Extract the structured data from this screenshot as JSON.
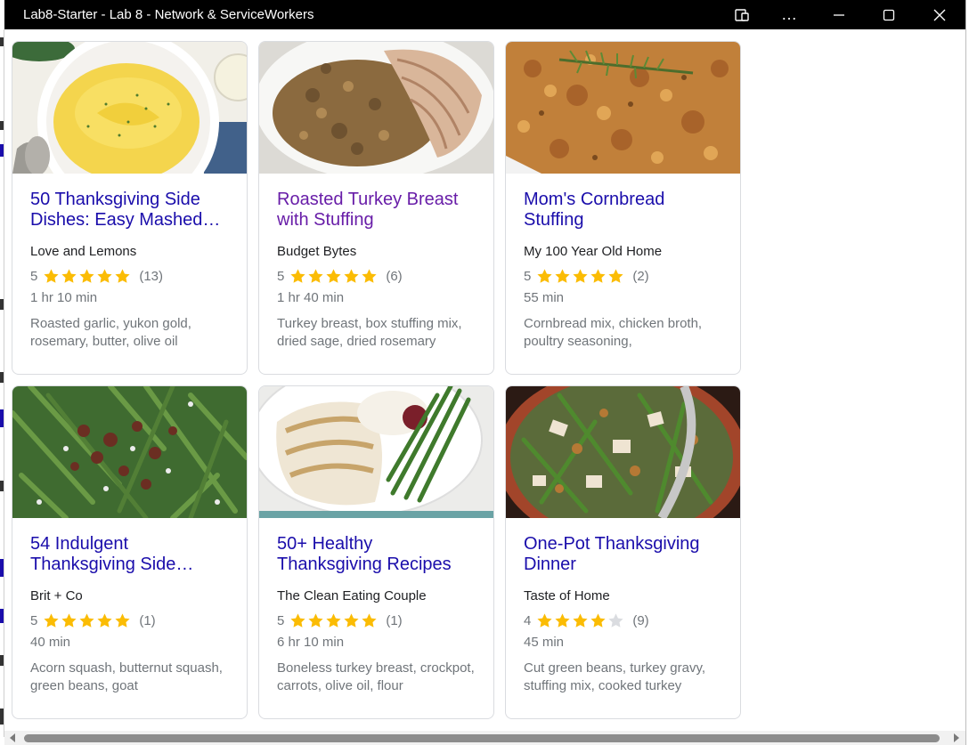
{
  "window": {
    "title": "Lab8-Starter - Lab 8 - Network & ServiceWorkers",
    "controls": {
      "app_icon": "⧉",
      "more": "…",
      "minimize": "—",
      "maximize": "□",
      "close": "✕"
    }
  },
  "colors": {
    "title_link": "#1a0dab",
    "visited_link": "#681da8",
    "star_filled": "#fbbc04",
    "star_empty": "#dadce0"
  },
  "recipes": [
    {
      "title": "50 Thanksgiving Side Dishes: Easy Mashed…",
      "visited": false,
      "source": "Love and Lemons",
      "rating": 5,
      "stars_filled": 5,
      "reviews": "(13)",
      "time": "1 hr 10 min",
      "ingredients": "Roasted garlic, yukon gold, rosemary, butter, olive oil",
      "image": "mashed-potatoes"
    },
    {
      "title": "Roasted Turkey Breast with Stuffing",
      "visited": true,
      "source": "Budget Bytes",
      "rating": 5,
      "stars_filled": 5,
      "reviews": "(6)",
      "time": "1 hr 40 min",
      "ingredients": "Turkey breast, box stuffing mix, dried sage, dried rosemary",
      "image": "turkey-with-stuffing"
    },
    {
      "title": "Mom's Cornbread Stuffing",
      "visited": false,
      "source": "My 100 Year Old Home",
      "rating": 5,
      "stars_filled": 5,
      "reviews": "(2)",
      "time": "55 min",
      "ingredients": "Cornbread mix, chicken broth, poultry seasoning,",
      "image": "cornbread-stuffing"
    },
    {
      "title": "54 Indulgent Thanksgiving Side…",
      "visited": false,
      "source": "Brit + Co",
      "rating": 5,
      "stars_filled": 5,
      "reviews": "(1)",
      "time": "40 min",
      "ingredients": "Acorn squash, butternut squash, green beans, goat",
      "image": "green-beans-pecans"
    },
    {
      "title": "50+ Healthy Thanksgiving Recipes",
      "visited": false,
      "source": "The Clean Eating Couple",
      "rating": 5,
      "stars_filled": 5,
      "reviews": "(1)",
      "time": "6 hr 10 min",
      "ingredients": "Boneless turkey breast, crockpot, carrots, olive oil, flour",
      "image": "sliced-turkey-plate"
    },
    {
      "title": "One-Pot Thanksgiving Dinner",
      "visited": false,
      "source": "Taste of Home",
      "rating": 4,
      "stars_filled": 4,
      "reviews": "(9)",
      "time": "45 min",
      "ingredients": "Cut green beans, turkey gravy, stuffing mix, cooked turkey",
      "image": "one-pot-skillet"
    }
  ]
}
